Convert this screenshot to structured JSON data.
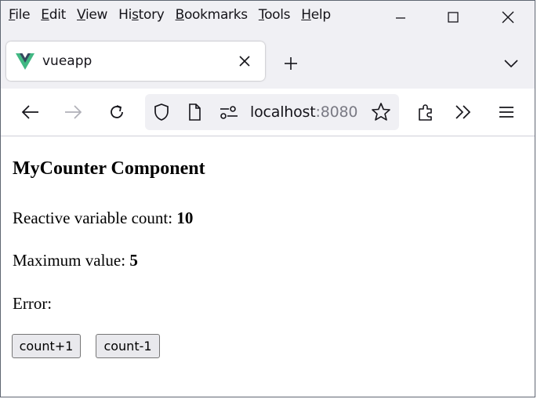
{
  "menu": {
    "items": [
      {
        "key": "F",
        "rest": "ile"
      },
      {
        "key": "E",
        "rest": "dit"
      },
      {
        "key": "V",
        "rest": "iew"
      },
      {
        "pre": "Hi",
        "key": "s",
        "rest": "tory"
      },
      {
        "key": "B",
        "rest": "ookmarks"
      },
      {
        "key": "T",
        "rest": "ools"
      },
      {
        "key": "H",
        "rest": "elp"
      }
    ]
  },
  "tab": {
    "title": "vueapp"
  },
  "urlbar": {
    "host": "localhost",
    "port": ":8080"
  },
  "page": {
    "title": "MyCounter Component",
    "count_label": "Reactive variable count: ",
    "count_value": "10",
    "max_label": "Maximum value: ",
    "max_value": "5",
    "error_label": "Error:",
    "inc_button": "count+1",
    "dec_button": "count-1"
  },
  "colors": {
    "vue_green": "#41b883",
    "vue_dark": "#34495e",
    "chrome_bg": "#f0f0f4"
  }
}
